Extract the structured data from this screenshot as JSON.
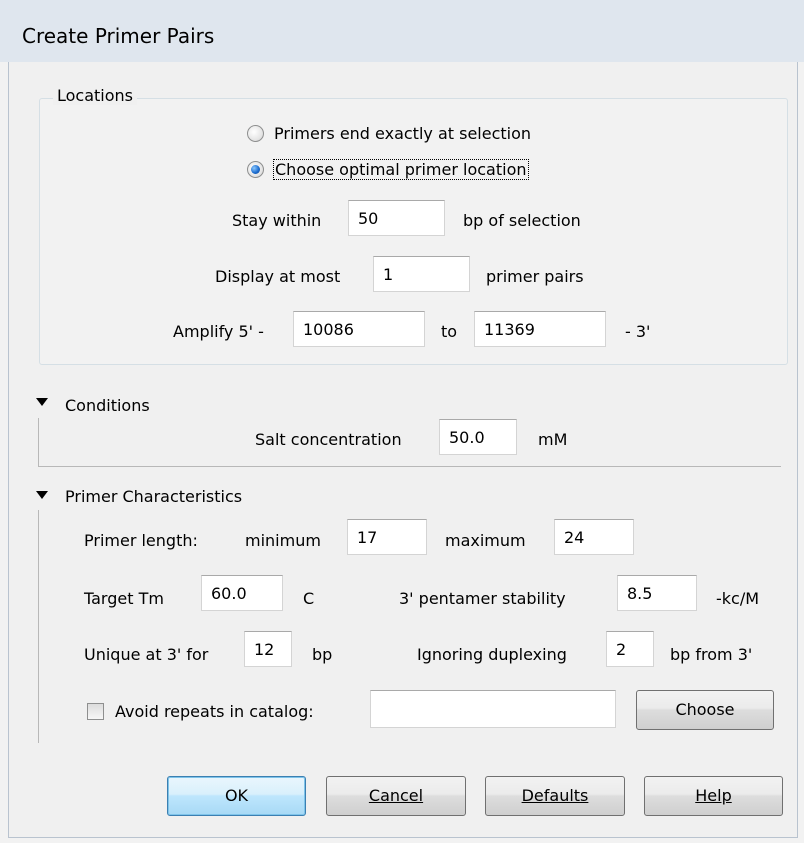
{
  "window": {
    "title": "Create Primer Pairs"
  },
  "locations": {
    "label": "Locations",
    "radio_exact": "Primers end exactly at selection",
    "radio_optimal": "Choose optimal primer location",
    "stay_within_label": "Stay within",
    "stay_within_value": "50",
    "stay_within_suffix": "bp of selection",
    "display_label": "Display at most",
    "display_value": "1",
    "display_suffix": "primer pairs",
    "amplify_label": "Amplify 5' -",
    "amplify_from": "10086",
    "amplify_to_label": "to",
    "amplify_to": "11369",
    "amplify_suffix": "- 3'"
  },
  "conditions": {
    "label": "Conditions",
    "salt_label": "Salt concentration",
    "salt_value": "50.0",
    "salt_unit": "mM"
  },
  "characteristics": {
    "label": "Primer Characteristics",
    "length_label": "Primer length:",
    "min_label": "minimum",
    "min_value": "17",
    "max_label": "maximum",
    "max_value": "24",
    "tm_label": "Target Tm",
    "tm_value": "60.0",
    "tm_unit": "C",
    "pentamer_label": "3' pentamer stability",
    "pentamer_value": "8.5",
    "pentamer_unit": "-kc/M",
    "unique_label": "Unique at 3' for",
    "unique_value": "12",
    "unique_unit": "bp",
    "duplex_label": "Ignoring duplexing",
    "duplex_value": "2",
    "duplex_unit": "bp from 3'",
    "avoid_label": "Avoid repeats in catalog:",
    "avoid_value": "",
    "choose_label": "Choose"
  },
  "buttons": {
    "ok": "OK",
    "cancel": "Cancel",
    "defaults": "Defaults",
    "help": "Help"
  }
}
